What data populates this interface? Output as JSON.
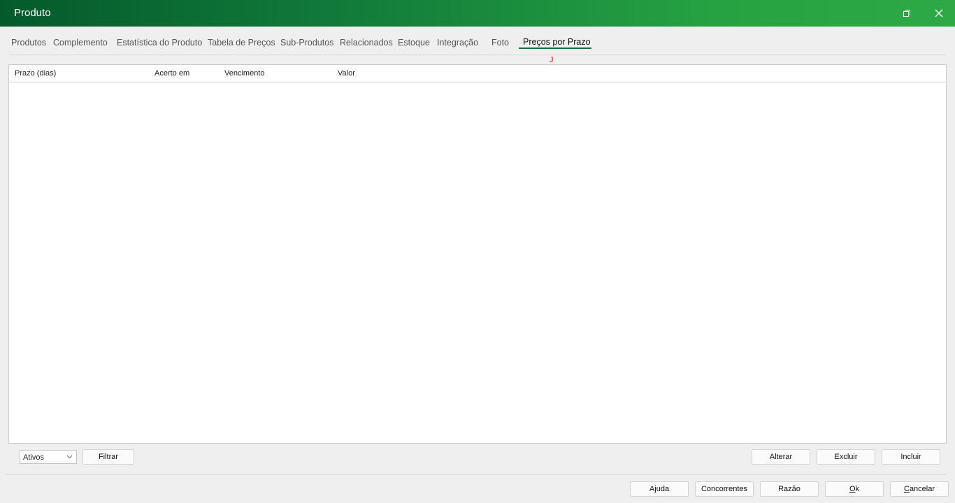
{
  "window": {
    "title": "Produto",
    "controls": [
      "restore-icon",
      "close-icon"
    ]
  },
  "tabs": [
    {
      "label": "Produtos"
    },
    {
      "label": "Complemento"
    },
    {
      "label": "Estatística do Produto"
    },
    {
      "label": "Tabela de Preços"
    },
    {
      "label": "Sub-Produtos"
    },
    {
      "label": "Relacionados"
    },
    {
      "label": "Estoque"
    },
    {
      "label": "Integração"
    },
    {
      "label": "Foto"
    },
    {
      "label": "Preços por Prazo",
      "active": true
    }
  ],
  "marker": "J",
  "grid": {
    "columns": [
      "Prazo (dias)",
      "Acerto em",
      "Vencimento",
      "Valor"
    ],
    "rows": []
  },
  "filter": {
    "status_selected": "Ativos",
    "filter_button": "Filtrar"
  },
  "actions": {
    "alterar": "Alterar",
    "excluir": "Excluir",
    "incluir": "Incluir"
  },
  "footer": {
    "ajuda": "Ajuda",
    "concorrentes": "Concorrentes",
    "razao": "Razão",
    "ok_accel": "O",
    "ok_rest": "k",
    "cancelar_accel": "C",
    "cancelar_rest": "ancelar"
  },
  "colors": {
    "accent": "#1a6b3a",
    "titlebar_start": "#045a2b",
    "titlebar_end": "#2ea946",
    "marker": "#d22020"
  }
}
